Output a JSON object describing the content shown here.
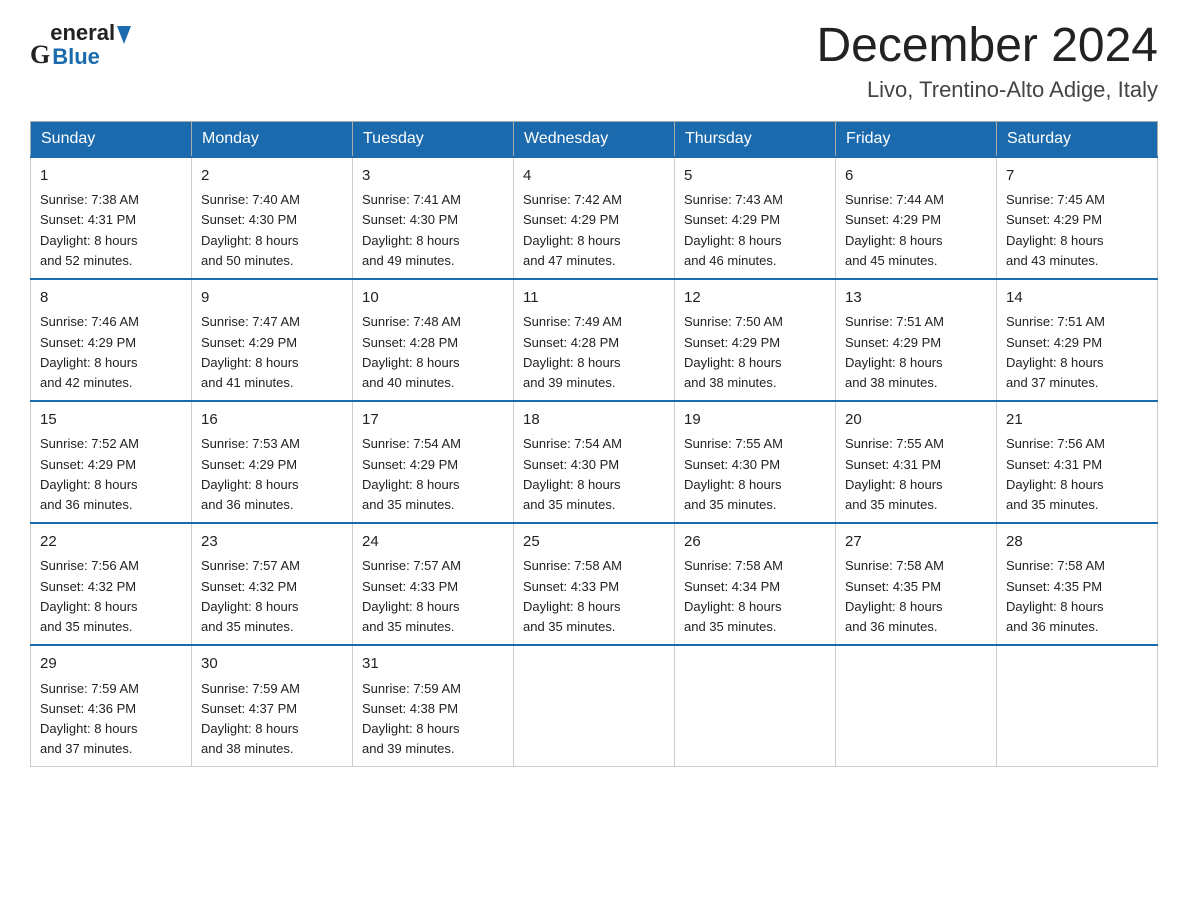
{
  "header": {
    "logo_general": "General",
    "logo_blue": "Blue",
    "month_title": "December 2024",
    "location": "Livo, Trentino-Alto Adige, Italy"
  },
  "days_of_week": [
    "Sunday",
    "Monday",
    "Tuesday",
    "Wednesday",
    "Thursday",
    "Friday",
    "Saturday"
  ],
  "weeks": [
    [
      {
        "day": "1",
        "sunrise": "7:38 AM",
        "sunset": "4:31 PM",
        "daylight": "8 hours and 52 minutes."
      },
      {
        "day": "2",
        "sunrise": "7:40 AM",
        "sunset": "4:30 PM",
        "daylight": "8 hours and 50 minutes."
      },
      {
        "day": "3",
        "sunrise": "7:41 AM",
        "sunset": "4:30 PM",
        "daylight": "8 hours and 49 minutes."
      },
      {
        "day": "4",
        "sunrise": "7:42 AM",
        "sunset": "4:29 PM",
        "daylight": "8 hours and 47 minutes."
      },
      {
        "day": "5",
        "sunrise": "7:43 AM",
        "sunset": "4:29 PM",
        "daylight": "8 hours and 46 minutes."
      },
      {
        "day": "6",
        "sunrise": "7:44 AM",
        "sunset": "4:29 PM",
        "daylight": "8 hours and 45 minutes."
      },
      {
        "day": "7",
        "sunrise": "7:45 AM",
        "sunset": "4:29 PM",
        "daylight": "8 hours and 43 minutes."
      }
    ],
    [
      {
        "day": "8",
        "sunrise": "7:46 AM",
        "sunset": "4:29 PM",
        "daylight": "8 hours and 42 minutes."
      },
      {
        "day": "9",
        "sunrise": "7:47 AM",
        "sunset": "4:29 PM",
        "daylight": "8 hours and 41 minutes."
      },
      {
        "day": "10",
        "sunrise": "7:48 AM",
        "sunset": "4:28 PM",
        "daylight": "8 hours and 40 minutes."
      },
      {
        "day": "11",
        "sunrise": "7:49 AM",
        "sunset": "4:28 PM",
        "daylight": "8 hours and 39 minutes."
      },
      {
        "day": "12",
        "sunrise": "7:50 AM",
        "sunset": "4:29 PM",
        "daylight": "8 hours and 38 minutes."
      },
      {
        "day": "13",
        "sunrise": "7:51 AM",
        "sunset": "4:29 PM",
        "daylight": "8 hours and 38 minutes."
      },
      {
        "day": "14",
        "sunrise": "7:51 AM",
        "sunset": "4:29 PM",
        "daylight": "8 hours and 37 minutes."
      }
    ],
    [
      {
        "day": "15",
        "sunrise": "7:52 AM",
        "sunset": "4:29 PM",
        "daylight": "8 hours and 36 minutes."
      },
      {
        "day": "16",
        "sunrise": "7:53 AM",
        "sunset": "4:29 PM",
        "daylight": "8 hours and 36 minutes."
      },
      {
        "day": "17",
        "sunrise": "7:54 AM",
        "sunset": "4:29 PM",
        "daylight": "8 hours and 35 minutes."
      },
      {
        "day": "18",
        "sunrise": "7:54 AM",
        "sunset": "4:30 PM",
        "daylight": "8 hours and 35 minutes."
      },
      {
        "day": "19",
        "sunrise": "7:55 AM",
        "sunset": "4:30 PM",
        "daylight": "8 hours and 35 minutes."
      },
      {
        "day": "20",
        "sunrise": "7:55 AM",
        "sunset": "4:31 PM",
        "daylight": "8 hours and 35 minutes."
      },
      {
        "day": "21",
        "sunrise": "7:56 AM",
        "sunset": "4:31 PM",
        "daylight": "8 hours and 35 minutes."
      }
    ],
    [
      {
        "day": "22",
        "sunrise": "7:56 AM",
        "sunset": "4:32 PM",
        "daylight": "8 hours and 35 minutes."
      },
      {
        "day": "23",
        "sunrise": "7:57 AM",
        "sunset": "4:32 PM",
        "daylight": "8 hours and 35 minutes."
      },
      {
        "day": "24",
        "sunrise": "7:57 AM",
        "sunset": "4:33 PM",
        "daylight": "8 hours and 35 minutes."
      },
      {
        "day": "25",
        "sunrise": "7:58 AM",
        "sunset": "4:33 PM",
        "daylight": "8 hours and 35 minutes."
      },
      {
        "day": "26",
        "sunrise": "7:58 AM",
        "sunset": "4:34 PM",
        "daylight": "8 hours and 35 minutes."
      },
      {
        "day": "27",
        "sunrise": "7:58 AM",
        "sunset": "4:35 PM",
        "daylight": "8 hours and 36 minutes."
      },
      {
        "day": "28",
        "sunrise": "7:58 AM",
        "sunset": "4:35 PM",
        "daylight": "8 hours and 36 minutes."
      }
    ],
    [
      {
        "day": "29",
        "sunrise": "7:59 AM",
        "sunset": "4:36 PM",
        "daylight": "8 hours and 37 minutes."
      },
      {
        "day": "30",
        "sunrise": "7:59 AM",
        "sunset": "4:37 PM",
        "daylight": "8 hours and 38 minutes."
      },
      {
        "day": "31",
        "sunrise": "7:59 AM",
        "sunset": "4:38 PM",
        "daylight": "8 hours and 39 minutes."
      },
      null,
      null,
      null,
      null
    ]
  ],
  "labels": {
    "sunrise": "Sunrise: ",
    "sunset": "Sunset: ",
    "daylight": "Daylight: "
  },
  "colors": {
    "header_bg": "#1a6aad",
    "header_text": "#ffffff",
    "border": "#aaaaaa",
    "row_border_top": "#1a6aad"
  }
}
